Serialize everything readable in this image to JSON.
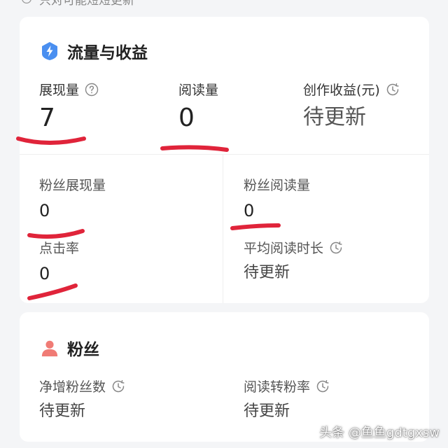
{
  "top_cut_text": "只对可能短短更新",
  "traffic": {
    "title": "流量与收益",
    "impressions": {
      "label": "展现量",
      "value": "7"
    },
    "reads": {
      "label": "阅读量",
      "value": "0"
    },
    "earnings": {
      "label": "创作收益(元)",
      "value": "待更新"
    },
    "fan_impressions": {
      "label": "粉丝展现量",
      "value": "0"
    },
    "fan_reads": {
      "label": "粉丝阅读量",
      "value": "0"
    },
    "ctr": {
      "label": "点击率",
      "value": "0"
    },
    "avg_read_time": {
      "label": "平均阅读时长",
      "value": "待更新"
    }
  },
  "fans": {
    "title": "粉丝",
    "net_fans": {
      "label": "净增粉丝数",
      "value": "待更新"
    },
    "read_to_fan": {
      "label": "阅读转粉率",
      "value": "待更新"
    }
  },
  "watermark": "头条 @鱼鱼gdtgxsw",
  "colors": {
    "accent_blue": "#4a8ff0",
    "fans_icon": "#f07b75",
    "annotation_red": "#e0243a",
    "card_bg": "#ffffff",
    "page_bg": "#f4f5f7"
  },
  "icons": {
    "traffic": "blue-shield-lightning-icon",
    "fans": "person-icon",
    "help": "question-circle-icon",
    "pending": "clock-icon"
  }
}
